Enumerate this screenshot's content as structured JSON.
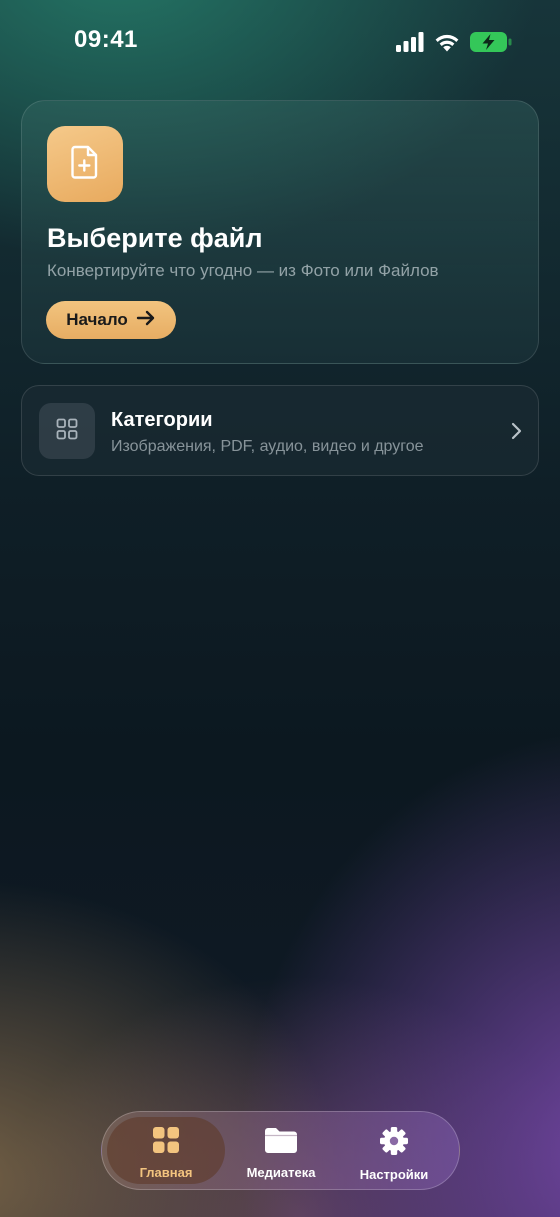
{
  "status_bar": {
    "time": "09:41",
    "icons": [
      "cellular-signal-icon",
      "wifi-icon",
      "battery-charging-icon"
    ],
    "battery_color": "#34c759"
  },
  "hero": {
    "icon": "file-add-icon",
    "title": "Выберите файл",
    "subtitle": "Конвертируйте что угодно — из Фото или Файлов",
    "start_button_label": "Начало",
    "accent_color": "#efbb74"
  },
  "categories": {
    "icon": "grid-icon",
    "title": "Категории",
    "subtitle": "Изображения, PDF, аудио, видео и другое"
  },
  "tab_bar": {
    "items": [
      {
        "label": "Главная",
        "icon": "grid-icon",
        "active": true
      },
      {
        "label": "Медиатека",
        "icon": "folder-icon",
        "active": false
      },
      {
        "label": "Настройки",
        "icon": "gear-icon",
        "active": false
      }
    ]
  }
}
